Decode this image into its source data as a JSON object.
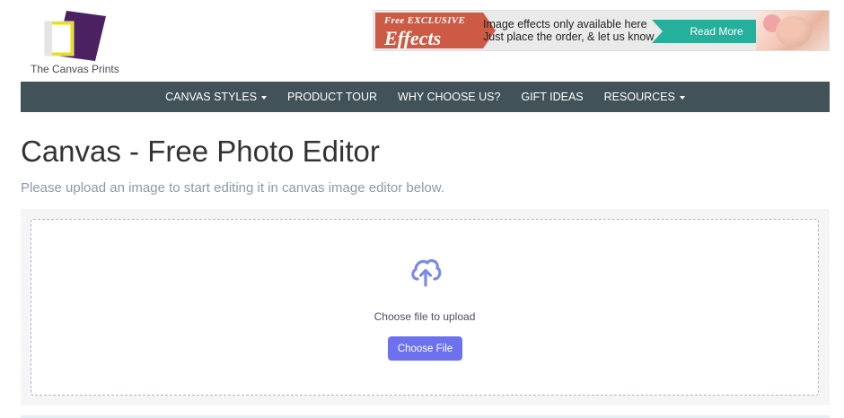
{
  "logo": {
    "text": "The Canvas Prints"
  },
  "banner": {
    "free_label": "Free EXCLUSIVE",
    "effects_label": "Effects",
    "line1": "Image effects only available here",
    "line2": "Just place the order, & let us know",
    "cta_label": "Read More"
  },
  "nav": {
    "items": [
      {
        "label": "CANVAS STYLES",
        "dropdown": true
      },
      {
        "label": "PRODUCT TOUR",
        "dropdown": false
      },
      {
        "label": "WHY CHOOSE US?",
        "dropdown": false
      },
      {
        "label": "GIFT IDEAS",
        "dropdown": false
      },
      {
        "label": "RESOURCES",
        "dropdown": true
      }
    ]
  },
  "page": {
    "title": "Canvas - Free Photo Editor",
    "subtitle": "Please upload an image to start editing it in canvas image editor below."
  },
  "upload": {
    "icon": "cloud-upload-icon",
    "label": "Choose file to upload",
    "button_label": "Choose File"
  },
  "colors": {
    "nav_bg": "#425259",
    "accent": "#6c72ee",
    "banner_red": "#cd5a44",
    "banner_teal": "#25b09c"
  }
}
